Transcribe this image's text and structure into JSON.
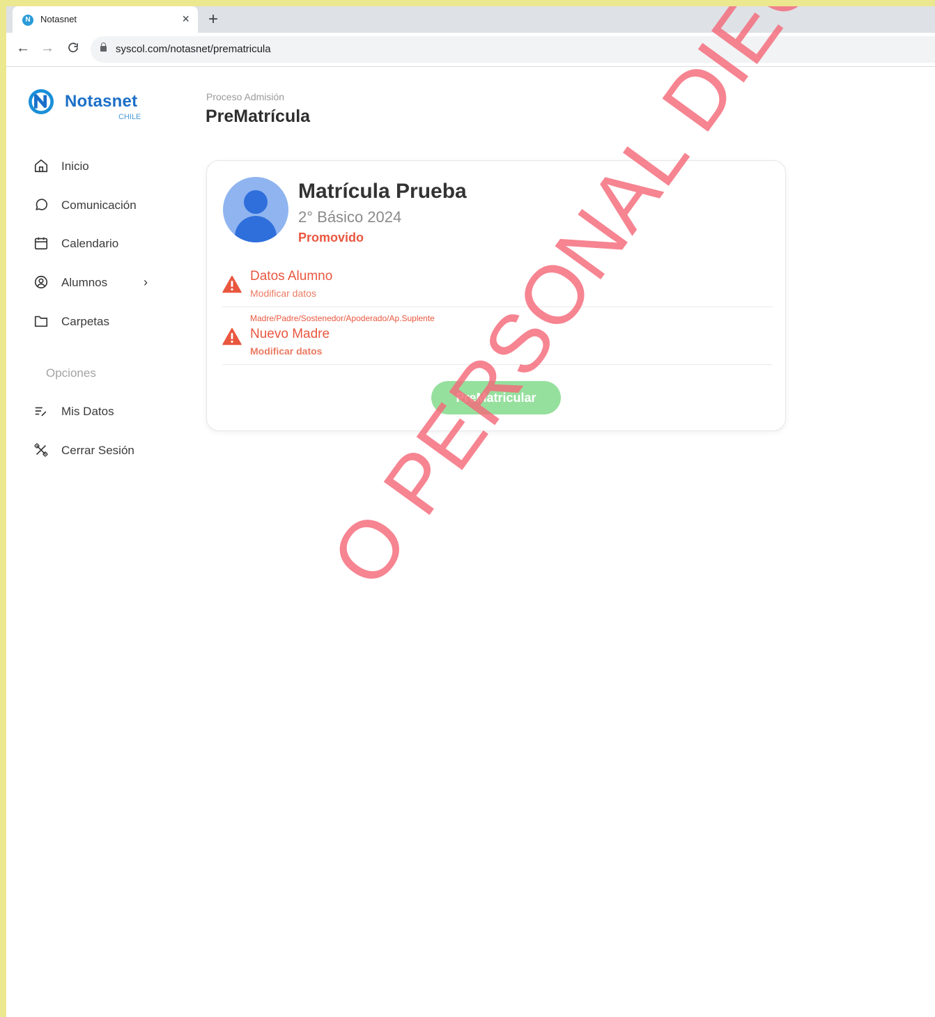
{
  "browser": {
    "tab_title": "Notasnet",
    "tab_close": "×",
    "new_tab": "+",
    "url": "syscol.com/notasnet/prematricula"
  },
  "brand": {
    "name": "Notasnet",
    "sub": "CHILE",
    "mark_letter": "N",
    "primary_color": "#1c6fc7"
  },
  "sidebar": {
    "items": [
      {
        "label": "Inicio",
        "icon": "home-icon"
      },
      {
        "label": "Comunicación",
        "icon": "chat-icon"
      },
      {
        "label": "Calendario",
        "icon": "calendar-icon"
      },
      {
        "label": "Alumnos",
        "icon": "user-circle-icon",
        "chevron": "›"
      },
      {
        "label": "Carpetas",
        "icon": "folder-icon"
      }
    ],
    "section_label": "Opciones",
    "options": [
      {
        "label": "Mis Datos",
        "icon": "list-edit-icon"
      },
      {
        "label": "Cerrar Sesión",
        "icon": "close-tools-icon"
      }
    ]
  },
  "header": {
    "breadcrumb": "Proceso Admisión",
    "title": "PreMatrícula"
  },
  "student": {
    "name": "Matrícula Prueba",
    "grade": "2° Básico 2024",
    "status": "Promovido",
    "status_color": "#e9573f"
  },
  "rows": [
    {
      "small": "",
      "title": "Datos Alumno",
      "action": "Modificar datos"
    },
    {
      "small": "Madre/Padre/Sostenedor/Apoderado/Ap.Suplente",
      "title": "Nuevo Madre",
      "action": "Modificar datos"
    }
  ],
  "action_button": {
    "label": "PreMatricular",
    "color": "#96e09e"
  },
  "watermark": "O PERSONAL DIEGO VELÁZQUE"
}
